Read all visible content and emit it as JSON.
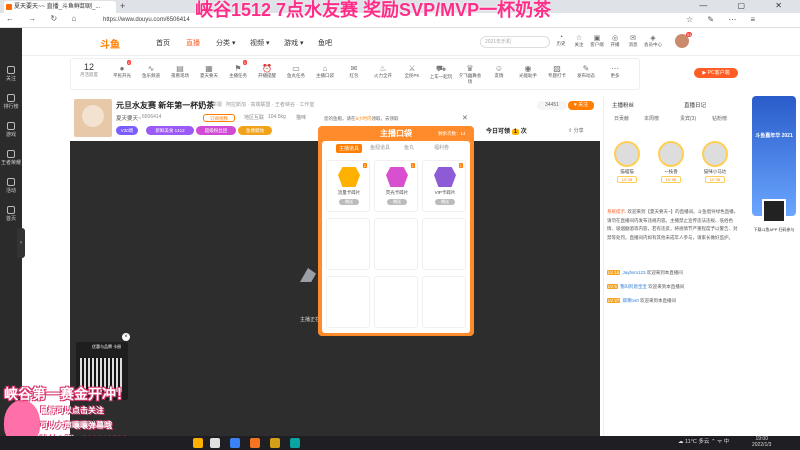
{
  "overlay_title": "峡谷1512  7点水友赛 奖励SVP/MVP一杯奶茶",
  "browser": {
    "tab_title": "夏天要天~~ 直播_斗鱼鲜卸剧_...",
    "url": "https://www.douyu.com/6506414",
    "nav": "← → ↻ ⌂",
    "winctrl": "— ▢ ✕",
    "toolbar": "☆ ✎ ⋯ ≡"
  },
  "leftbar": [
    {
      "label": "关注"
    },
    {
      "label": "排行榜"
    },
    {
      "label": "游戏"
    },
    {
      "label": "王者荣耀"
    },
    {
      "label": "活动"
    },
    {
      "label": "首页"
    }
  ],
  "header": {
    "logo": "斗鱼",
    "nav": [
      "首页",
      "直播",
      "分类 ▾",
      "视频 ▾",
      "游戏 ▾",
      "鱼吧"
    ],
    "search_placeholder": "2021年乐机",
    "icons": [
      {
        "g": "◔",
        "label": "历史"
      },
      {
        "g": "☆",
        "label": "关注"
      },
      {
        "g": "▣",
        "label": "客户端"
      },
      {
        "g": "◎",
        "label": "开播"
      },
      {
        "g": "✉",
        "label": "消息"
      },
      {
        "g": "◈",
        "label": "会员中心"
      }
    ],
    "avatar_badge": "51"
  },
  "strip": {
    "day": "12",
    "day_sub": "月活跃度",
    "items": [
      {
        "g": "●",
        "label": "平民开光",
        "badge": "2"
      },
      {
        "g": "∿",
        "label": "鱼乐频道"
      },
      {
        "g": "▤",
        "label": "夜看现场"
      },
      {
        "g": "▦",
        "label": "夏天要天"
      },
      {
        "g": "⚑",
        "label": "主播任务",
        "badge": "1"
      },
      {
        "g": "⏰",
        "label": "开播提醒"
      },
      {
        "g": "▭",
        "label": "鱼丸任务"
      },
      {
        "g": "⌂",
        "label": "主播口袋"
      },
      {
        "g": "✉",
        "label": "红包"
      },
      {
        "g": "♨",
        "label": "火力全开"
      },
      {
        "g": "⚔",
        "label": "全民PK"
      },
      {
        "g": "⛟",
        "label": "上车一起玩"
      },
      {
        "g": "♛",
        "label": "夕飞幽舞会场"
      },
      {
        "g": "☺",
        "label": "友情"
      },
      {
        "g": "◉",
        "label": "光能助手"
      },
      {
        "g": "▧",
        "label": "专题打卡"
      },
      {
        "g": "✎",
        "label": "发布动态"
      },
      {
        "g": "⋯",
        "label": "更多"
      }
    ],
    "pc_button": "▶ PC客户端"
  },
  "room": {
    "title": "元旦水友赛 新年第一杯奶茶",
    "report": "举报",
    "meta": "阿拉斯加  · 高端联盟 · 王者峡谷 · 工作室",
    "anchor": "夏天要天~",
    "room_id": "6506414",
    "subscribe": "订阅视频",
    "tags": [
      "地区互联",
      "104.5kg",
      "猫咪",
      "王者"
    ],
    "pills": [
      "V30周",
      "新鲜美食 1412",
      "超级粉丝团",
      "鱼塘蜡烛"
    ],
    "viewers": "34451",
    "follow": "♥ 关注",
    "today_label": "今日可领",
    "today_num": "1",
    "today_unit": "次",
    "share": "⇪ 分享"
  },
  "video": {
    "caption": "主播正在赶来"
  },
  "popup": {
    "hint": "您的鱼粮，请在",
    "hint_link": "5小时内",
    "hint_tail": "领取，去领取",
    "title": "主播口袋",
    "tabs": [
      "主播道具",
      "鱼翅道具",
      "鱼丸",
      "福利卷"
    ],
    "left_info": "剩余次数：14",
    "gifts": [
      {
        "name": "流量卡碎片",
        "btn": "赠送",
        "qty": "2",
        "color": "#ffb100"
      },
      {
        "name": "荧光卡碎片",
        "btn": "赠送",
        "qty": "1",
        "color": "#d84fcf"
      },
      {
        "name": "VIP卡碎片",
        "btn": "赠送",
        "qty": "1",
        "color": "#8d5bd6"
      }
    ]
  },
  "rpanel": {
    "tabs": [
      "主播粉丝",
      "直播日记"
    ],
    "subtabs": [
      "日贡献",
      "本周榜",
      "贵宾(3)",
      "钻粉榜"
    ],
    "ranks": [
      {
        "name": "猫喵猫",
        "lv": "LV 28"
      },
      {
        "name": "一枝香",
        "lv": "LV 96"
      },
      {
        "name": "猫咪小马达",
        "lv": "LV 26"
      }
    ],
    "sys_key": "系统提示:",
    "sys_text": "欢迎来到【夏天要天~】的直播间。斗鱼倡导绿色直播，请勿在直播间内发布违规内容。主播禁止宣传违法违规、低俗色情、吸烟酗酒等内容，若有违反，将视情节严重程度予以警告、封禁等处罚。直播间内如有其他未成年人参与，请家长做好监护。",
    "chats": [
      {
        "lv": "LV 16",
        "user": "Jaybsm123",
        "text": "欢迎来到本直播间"
      },
      {
        "lv": "LV 6",
        "user": "我叫阿恩宝宝",
        "text": "欢迎来到本直播间"
      },
      {
        "lv": "LV 27",
        "user": "耶莱bs0",
        "text": "欢迎来到本直播间"
      }
    ]
  },
  "ad": {
    "title": "斗鱼嘉年华 2021",
    "sub": "下载斗鱼APP 扫码参与"
  },
  "overlay": {
    "qr_title": "优惠与品牌\n卡册",
    "big": "峡谷第一赛金开冲！",
    "line1": "鼠标可以点击关注",
    "line2": "可以大声嚷嚷弹幕哦",
    "line3": "粉丝Q群：861646890"
  },
  "taskbar": {
    "tray": "☁ 11°C 多云  ⌃ ᯤ 中",
    "time": "19:00",
    "date": "2022/1/3"
  }
}
